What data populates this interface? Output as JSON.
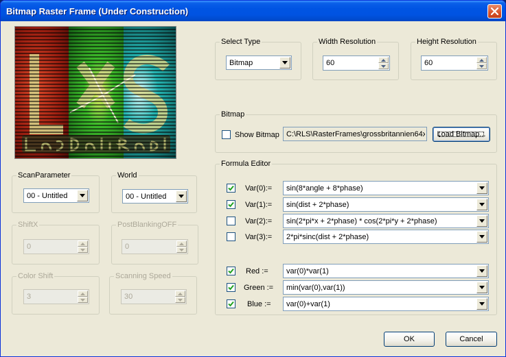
{
  "window": {
    "title": "Bitmap Raster Frame (Under Construction)"
  },
  "preview": {
    "colors": [
      "#c0301c",
      "#1f9a24",
      "#1aa8a6"
    ]
  },
  "scan_parameter": {
    "label": "ScanParameter",
    "value": "00 - Untitled"
  },
  "world": {
    "label": "World",
    "value": "00 - Untitled"
  },
  "shift_x": {
    "label": "ShiftX",
    "value": "0"
  },
  "post_blanking_off": {
    "label": "PostBlankingOFF",
    "value": "0"
  },
  "color_shift": {
    "label": "Color Shift",
    "value": "3"
  },
  "scanning_speed": {
    "label": "Scanning Speed",
    "value": "30"
  },
  "select_type": {
    "label": "Select Type",
    "value": "Bitmap"
  },
  "width_resolution": {
    "label": "Width Resolution",
    "value": "60"
  },
  "height_resolution": {
    "label": "Height Resolution",
    "value": "60"
  },
  "bitmap": {
    "label": "Bitmap",
    "show_bitmap_label": "Show Bitmap",
    "show_bitmap_checked": false,
    "path": "C:\\RLS\\RasterFrames\\grossbritannien64x",
    "load_button": "Load Bitmap..."
  },
  "formula_editor": {
    "label": "Formula Editor",
    "vars": [
      {
        "label": "Var(0):=",
        "checked": true,
        "formula": "sin(8*angle + 8*phase)"
      },
      {
        "label": "Var(1):=",
        "checked": true,
        "formula": "sin(dist + 2*phase)"
      },
      {
        "label": "Var(2):=",
        "checked": false,
        "formula": "sin(2*pi*x + 2*phase) * cos(2*pi*y + 2*phase)"
      },
      {
        "label": "Var(3):=",
        "checked": false,
        "formula": "2*pi*sinc(dist + 2*phase)"
      }
    ],
    "colors": [
      {
        "label": "Red :=",
        "checked": true,
        "formula": "var(0)*var(1)"
      },
      {
        "label": "Green :=",
        "checked": true,
        "formula": "min(var(0),var(1))"
      },
      {
        "label": "Blue :=",
        "checked": true,
        "formula": "var(0)+var(1)"
      }
    ]
  },
  "buttons": {
    "ok": "OK",
    "cancel": "Cancel"
  }
}
